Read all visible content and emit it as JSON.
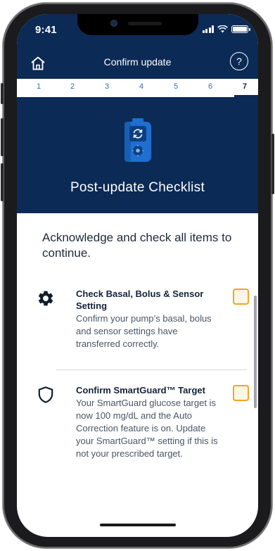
{
  "status_bar": {
    "time": "9:41"
  },
  "header": {
    "title": "Confirm update",
    "help_label": "?"
  },
  "steps": {
    "items": [
      "1",
      "2",
      "3",
      "4",
      "5",
      "6",
      "7"
    ],
    "current": 7
  },
  "hero": {
    "title": "Post-update Checklist",
    "illustration": "pump-update-icon"
  },
  "instructions": "Acknowledge and check  all items to continue.",
  "checklist": [
    {
      "icon": "gear-icon",
      "title": "Check Basal, Bolus & Sensor Setting",
      "description": "Confirm your pump’s basal, bolus and sensor settings have transferred correctly.",
      "checked": false
    },
    {
      "icon": "shield-icon",
      "title": "Confirm SmartGuard™ Target",
      "description": "Your SmartGuard glucose target is now 100 mg/dL and the Auto Correction feature is on. Update your SmartGuard™ setting if this is not your prescribed target.",
      "checked": false
    }
  ],
  "colors": {
    "navy": "#0b2a55",
    "step_blue": "#3a6fb5",
    "checkbox_border": "#f0a529",
    "checkbox_fill": "#fdf6e6",
    "pump_blue": "#1e6fd0"
  }
}
